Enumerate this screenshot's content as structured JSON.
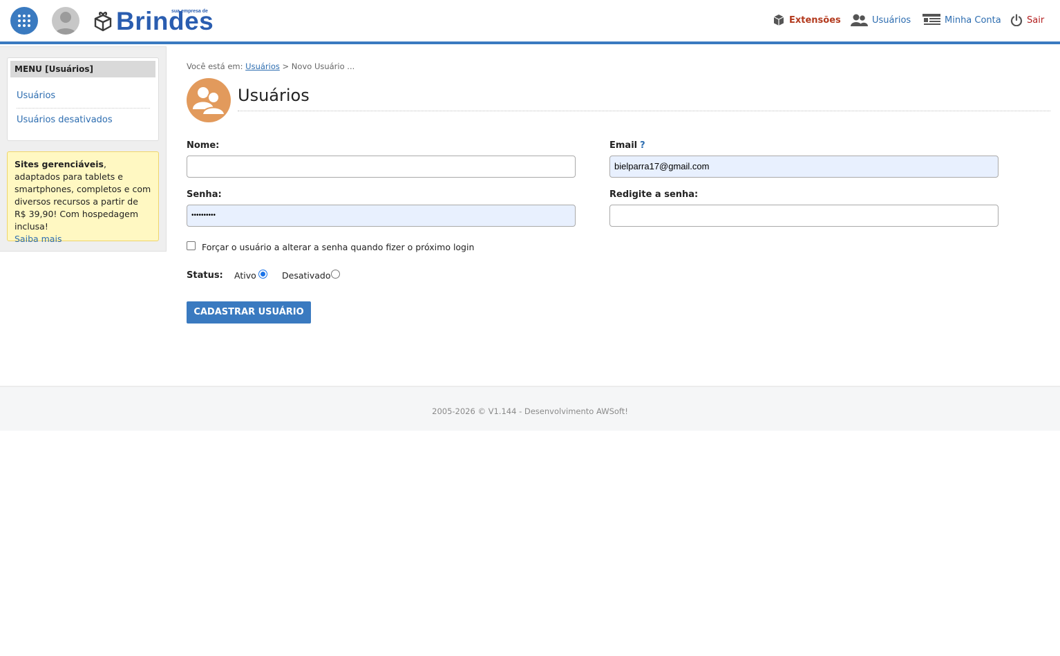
{
  "header": {
    "logo_tagline": "sua empresa de",
    "logo_word": "Brindes",
    "nav": [
      {
        "label": "Extensões",
        "icon": "cube-icon"
      },
      {
        "label": "Usuários",
        "icon": "users-icon"
      },
      {
        "label": "Minha Conta",
        "icon": "account-list-icon"
      },
      {
        "label": "Sair",
        "icon": "power-icon"
      }
    ],
    "colors": {
      "accent": "#3a7ac0",
      "extensions": "#b33a1e",
      "logout": "#b31e1e"
    }
  },
  "sidebar": {
    "menu_title": "MENU [Usuários]",
    "items": [
      {
        "label": "Usuários"
      },
      {
        "label": "Usuários desativados"
      }
    ],
    "promo": {
      "bold": "Sites gerenciáveis",
      "text": ", adaptados para tablets e smartphones, completos e com diversos recursos a partir de R$ 39,90! Com hospedagem inclusa!",
      "link": "Saiba mais"
    }
  },
  "main": {
    "breadcrumb": {
      "prefix": "Você está em:",
      "link": "Usuários",
      "current": "> Novo Usuário ..."
    },
    "title": "Usuários",
    "form": {
      "nome_label": "Nome:",
      "nome_value": "",
      "email_label": "Email",
      "email_help": "?",
      "email_value": "bielparra17@gmail.com",
      "senha_label": "Senha:",
      "senha_value": "••••••••••",
      "resenha_label": "Redigite a senha:",
      "resenha_value": "",
      "force_change_label": "Forçar o usuário a alterar a senha quando fizer o próximo login",
      "force_change_checked": false,
      "status_label": "Status:",
      "status_options": [
        {
          "label": "Ativo",
          "selected": true
        },
        {
          "label": "Desativado",
          "selected": false
        }
      ],
      "submit_label": "CADASTRAR USUÁRIO"
    }
  },
  "footer": {
    "text": "2005-2026 © V1.144 - Desenvolvimento AWSoft!"
  }
}
